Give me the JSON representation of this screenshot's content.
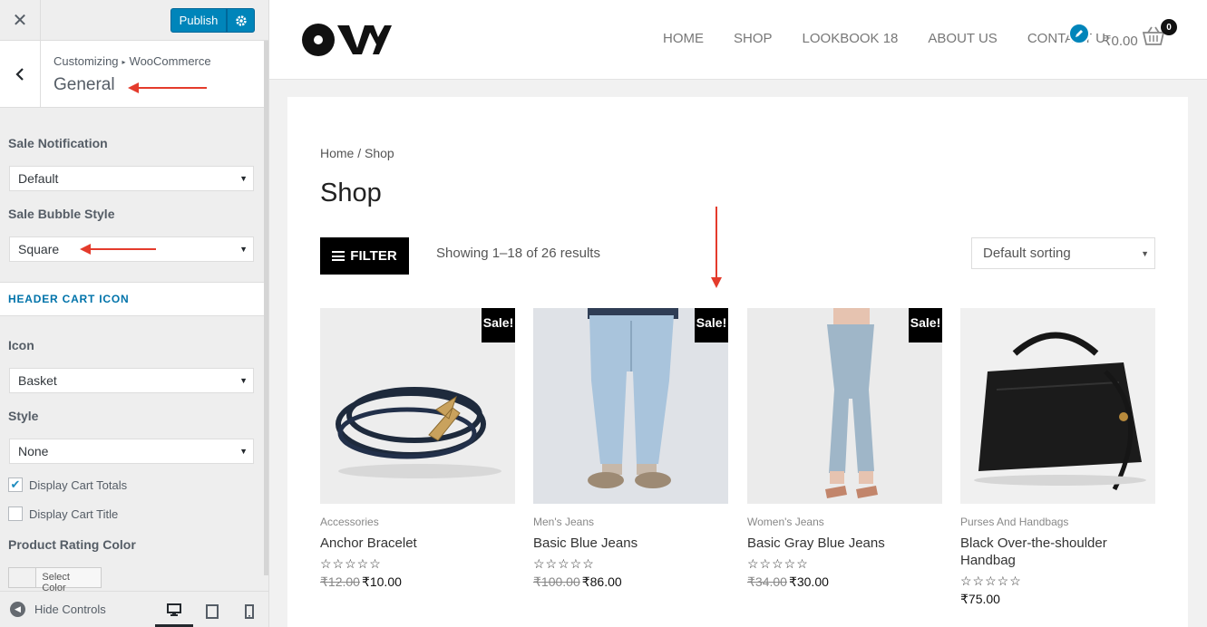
{
  "customizer": {
    "close_icon": "close-icon",
    "publish_label": "Publish",
    "breadcrumb_root": "Customizing",
    "breadcrumb_section": "WooCommerce",
    "section_title": "General",
    "sale_notification_label": "Sale Notification",
    "sale_notification_value": "Default",
    "sale_bubble_label": "Sale Bubble Style",
    "sale_bubble_value": "Square",
    "header_cart_icon_heading": "HEADER CART ICON",
    "icon_label": "Icon",
    "icon_value": "Basket",
    "style_label": "Style",
    "style_value": "None",
    "display_cart_totals_label": "Display Cart Totals",
    "display_cart_totals_checked": true,
    "display_cart_title_label": "Display Cart Title",
    "display_cart_title_checked": false,
    "rating_color_label": "Product Rating Color",
    "select_color_label": "Select Color",
    "hide_controls_label": "Hide Controls"
  },
  "site": {
    "nav": [
      "HOME",
      "SHOP",
      "LOOKBOOK 18",
      "ABOUT US",
      "CONTACT U"
    ],
    "cart_total": "₹0.00",
    "cart_count": "0"
  },
  "shop": {
    "breadcrumb": "Home / Shop",
    "title": "Shop",
    "filter_label": "FILTER",
    "result_count": "Showing 1–18 of 26 results",
    "sorting_value": "Default sorting",
    "sale_label": "Sale!",
    "stars": "☆☆☆☆☆",
    "products": [
      {
        "category": "Accessories",
        "name": "Anchor Bracelet",
        "old_price": "₹12.00",
        "price": "₹10.00"
      },
      {
        "category": "Men's Jeans",
        "name": "Basic Blue Jeans",
        "old_price": "₹100.00",
        "price": "₹86.00"
      },
      {
        "category": "Women's Jeans",
        "name": "Basic Gray Blue Jeans",
        "old_price": "₹34.00",
        "price": "₹30.00"
      },
      {
        "category": "Purses And Handbags",
        "name": "Black Over-the-shoulder Handbag",
        "old_price": "",
        "price": "₹75.00"
      }
    ]
  },
  "colors": {
    "accent": "#0085ba",
    "annotation_arrow": "#e43b2c"
  }
}
